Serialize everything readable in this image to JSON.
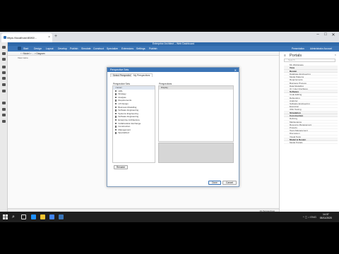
{
  "browser": {
    "tab_title": "https://localhost:8080/...",
    "new_tab": "+",
    "window_controls": [
      "–",
      "□",
      "✕"
    ]
  },
  "app": {
    "title": "Enterprise Architect – Web Dashboard",
    "menu": [
      "Start",
      "Design",
      "Layout",
      "Develop",
      "Publish",
      "Simulate",
      "Construct",
      "Specialize",
      "Extensions",
      "Settings",
      "Publish"
    ],
    "menu_right": [
      "Presentation",
      "Administrator Account"
    ],
    "breadcrumb": "‹ › Model > ... > Diagram",
    "sub_header": "View name"
  },
  "portal": {
    "title": "Portals",
    "search_placeholder": "Search",
    "items": [
      {
        "type": "item",
        "label": "My Workspace"
      },
      {
        "type": "group",
        "label": "View"
      },
      {
        "type": "group",
        "label": "Design"
      },
      {
        "type": "item",
        "label": "Database Engineering"
      },
      {
        "type": "item",
        "label": "Model Patterns"
      },
      {
        "type": "item",
        "label": "Requirements"
      },
      {
        "type": "item",
        "label": "Business Process"
      },
      {
        "type": "item",
        "label": "Data Modelling"
      },
      {
        "type": "item",
        "label": "UI / User Interfaces"
      },
      {
        "type": "group",
        "label": "Software"
      },
      {
        "type": "item",
        "label": "Code Editing"
      },
      {
        "type": "item",
        "label": "Debugging"
      },
      {
        "type": "item",
        "label": "Analyzer"
      },
      {
        "type": "item",
        "label": "Software Engineering"
      },
      {
        "type": "item",
        "label": "Execution"
      },
      {
        "type": "item",
        "label": "UML Testing"
      },
      {
        "type": "group",
        "label": "Simulation"
      },
      {
        "type": "group",
        "label": "Construction"
      },
      {
        "type": "item",
        "label": "Defining"
      },
      {
        "type": "item",
        "label": "Maintenance"
      },
      {
        "type": "item",
        "label": "Resource Management"
      },
      {
        "type": "item",
        "label": "Projects"
      },
      {
        "type": "item",
        "label": "Team Management"
      },
      {
        "type": "item",
        "label": "Discussion"
      },
      {
        "type": "item",
        "label": "Visual Tests"
      },
      {
        "type": "group",
        "label": "Model & Design"
      },
      {
        "type": "item",
        "label": "Model Portals"
      }
    ]
  },
  "status": {
    "right": "All Perspectives"
  },
  "taskbar": {
    "search_glyph": "⌕",
    "tray": "^ ◻ ♪ ENG",
    "time": "14:37",
    "date": "05/11/2020"
  },
  "modal": {
    "title": "Perspective Sets",
    "close": "✕",
    "tabs": [
      "Select Perspectives",
      "My Perspectives"
    ],
    "left_label": "Perspective Sets",
    "right_label": "Perspectives",
    "list": [
      {
        "label": "<none>",
        "selected": true,
        "checkbox": false
      },
      {
        "label": "UML",
        "selected": false,
        "checkbox": true
      },
      {
        "label": "Strategy",
        "selected": false,
        "checkbox": true
      },
      {
        "label": "Analysis",
        "selected": false,
        "checkbox": true
      },
      {
        "label": "Requirements",
        "selected": false,
        "checkbox": true
      },
      {
        "label": "UX Design",
        "selected": false,
        "checkbox": true
      },
      {
        "label": "Business Modelling",
        "selected": false,
        "checkbox": true
      },
      {
        "label": "Software Engineering",
        "selected": false,
        "checkbox": true
      },
      {
        "label": "Systems Engineering",
        "selected": false,
        "checkbox": true
      },
      {
        "label": "Software Engineering",
        "selected": false,
        "checkbox": true
      },
      {
        "label": "Enterprise Architecture",
        "selected": false,
        "checkbox": true
      },
      {
        "label": "Collaboration Exchange",
        "selected": false,
        "checkbox": true
      },
      {
        "label": "Construction",
        "selected": false,
        "checkbox": true
      },
      {
        "label": "Management",
        "selected": false,
        "checkbox": true
      },
      {
        "label": "Specialized",
        "selected": false,
        "checkbox": true
      }
    ],
    "params_row": "Display",
    "rename_button": "Rename",
    "ok_button": "Done",
    "cancel_button": "Cancel"
  },
  "colors": {
    "accent": "#3a74b6",
    "title_bar": "#2e68a8",
    "taskbar": "#1f1f1f"
  }
}
